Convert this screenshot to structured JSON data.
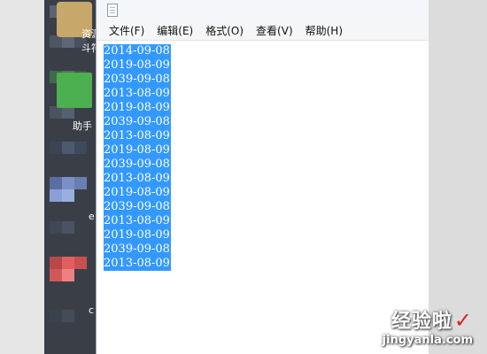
{
  "desktop": {
    "labels": [
      "资源",
      "斗符",
      "助手",
      "e",
      "c"
    ]
  },
  "notepad": {
    "menu": [
      "文件(F)",
      "编辑(E)",
      "格式(O)",
      "查看(V)",
      "帮助(H)"
    ],
    "lines": [
      "2014-09-08",
      "2019-08-09",
      "2039-09-08",
      "2013-08-09",
      "2019-08-09",
      "2039-09-08",
      "2013-08-09",
      "2019-08-09",
      "2039-09-08",
      "2013-08-09",
      "2019-08-09",
      "2039-09-08",
      "2013-08-09",
      "2019-08-09",
      "2039-09-08",
      "2013-08-09"
    ],
    "selection_color": "#3399ff"
  },
  "watermark": {
    "text": "经验啦",
    "url": "jingyanla.com"
  }
}
